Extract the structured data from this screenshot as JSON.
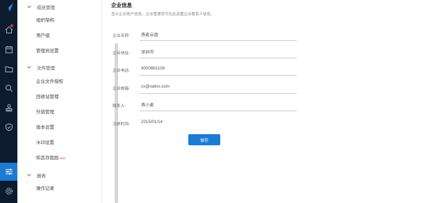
{
  "colors": {
    "rail_bg": "#0d1b2e",
    "accent": "#1c7bd3",
    "badge": "#e53935"
  },
  "rail": {
    "icons": [
      "home-icon",
      "calendar-icon",
      "folder-icon",
      "search-icon",
      "stamp-icon",
      "shield-icon",
      "sliders-icon",
      "gear-icon"
    ],
    "active": "sliders-icon"
  },
  "submenu": {
    "groups": [
      {
        "label": "成员管理",
        "items": [
          "组织架构",
          "用户组",
          "管理员设置"
        ]
      },
      {
        "label": "文件管理",
        "items": [
          "企业文件授权",
          "回收站管理",
          "外链管理",
          "版本设置",
          "水印设置",
          "知态存般励"
        ]
      },
      {
        "label": "报表",
        "items": [
          "操作记录"
        ]
      }
    ],
    "new_badge": "new"
  },
  "main": {
    "title": "企业信息",
    "subtitle": "显示企业账户信息，企业管理员可在此设置企业联系人信息。",
    "fields": [
      {
        "label": "企业名称:",
        "value": "燕麦云盘"
      },
      {
        "label": "企业地址:",
        "value": "深圳市"
      },
      {
        "label": "企业电话:",
        "value": "4000861108"
      },
      {
        "label": "企业邮箱:",
        "value": "cs@oatos.com"
      },
      {
        "label": "联系人:",
        "value": "燕小麦"
      }
    ],
    "register": {
      "label": "注册时间:",
      "value": "2015/01/14"
    },
    "save_label": "保存"
  }
}
